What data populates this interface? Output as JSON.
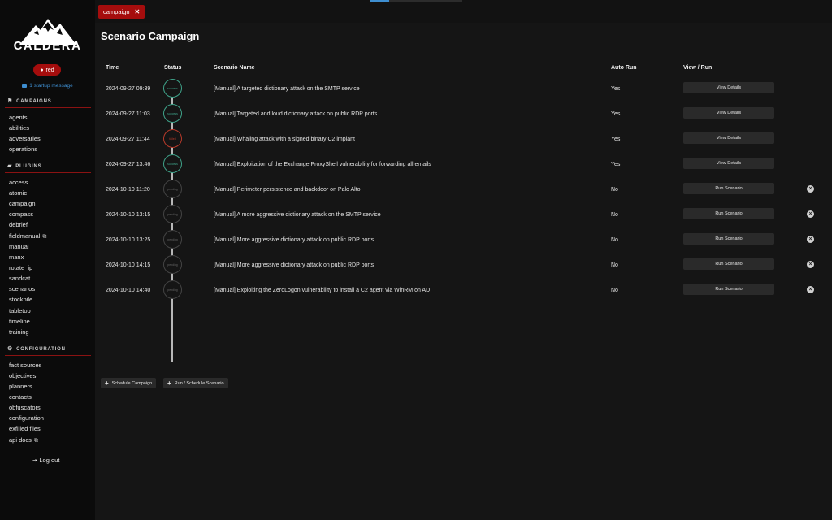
{
  "app": {
    "logo_text": "CALDERA"
  },
  "user": {
    "name": "red"
  },
  "startup": {
    "message": "1 startup message"
  },
  "sidebar": {
    "campaigns_header": "CAMPAIGNS",
    "campaigns": [
      "agents",
      "abilities",
      "adversaries",
      "operations"
    ],
    "plugins_header": "PLUGINS",
    "plugins": [
      "access",
      "atomic",
      "campaign",
      "compass",
      "debrief",
      "fieldmanual",
      "manual",
      "manx",
      "rotate_ip",
      "sandcat",
      "scenarios",
      "stockpile",
      "tabletop",
      "timeline",
      "training"
    ],
    "config_header": "CONFIGURATION",
    "configuration": [
      "fact sources",
      "objectives",
      "planners",
      "contacts",
      "obfuscators",
      "configuration",
      "exfilled files",
      "api docs"
    ],
    "logout": "Log out"
  },
  "tab": {
    "label": "campaign",
    "close": "✕"
  },
  "page": {
    "title": "Scenario Campaign"
  },
  "table": {
    "headers": {
      "time": "Time",
      "status": "Status",
      "scenario": "Scenario Name",
      "auto_run": "Auto Run",
      "view_run": "View / Run"
    },
    "rows": [
      {
        "time": "2024-09-27 09:39",
        "status": "success",
        "name": "[Manual] A targeted dictionary attack on the SMTP service",
        "auto_run": "Yes",
        "action": "View Details",
        "deletable": false
      },
      {
        "time": "2024-09-27 11:03",
        "status": "success",
        "name": "[Manual] Targeted and loud dictionary attack on public RDP ports",
        "auto_run": "Yes",
        "action": "View Details",
        "deletable": false
      },
      {
        "time": "2024-09-27 11:44",
        "status": "failed",
        "name": "[Manual] Whaling attack with a signed binary C2 implant",
        "auto_run": "Yes",
        "action": "View Details",
        "deletable": false
      },
      {
        "time": "2024-09-27 13:46",
        "status": "success",
        "name": "[Manual] Exploitation of the Exchange ProxyShell vulnerability for forwarding all emails",
        "auto_run": "Yes",
        "action": "View Details",
        "deletable": false
      },
      {
        "time": "2024-10-10 11:20",
        "status": "pending",
        "name": "[Manual] Perimeter persistence and backdoor on Palo Alto",
        "auto_run": "No",
        "action": "Run Scenario",
        "deletable": true
      },
      {
        "time": "2024-10-10 13:15",
        "status": "pending",
        "name": "[Manual] A more aggressive dictionary attack on the SMTP service",
        "auto_run": "No",
        "action": "Run Scenario",
        "deletable": true
      },
      {
        "time": "2024-10-10 13:25",
        "status": "pending",
        "name": "[Manual] More aggressive dictionary attack on public RDP ports",
        "auto_run": "No",
        "action": "Run Scenario",
        "deletable": true
      },
      {
        "time": "2024-10-10 14:15",
        "status": "pending",
        "name": "[Manual] More aggressive dictionary attack on public RDP ports",
        "auto_run": "No",
        "action": "Run Scenario",
        "deletable": true
      },
      {
        "time": "2024-10-10 14:40",
        "status": "pending",
        "name": "[Manual] Exploiting the ZeroLogon vulnerability to install a C2 agent via WinRM on AD",
        "auto_run": "No",
        "action": "Run Scenario",
        "deletable": true
      }
    ]
  },
  "actions": {
    "schedule_campaign": "Schedule Campaign",
    "run_schedule": "Run / Schedule Scenario"
  },
  "colors": {
    "accent": "#a50d0d",
    "success": "#3fa38a",
    "failed": "#b83a2a",
    "link": "#3e8ed0"
  }
}
